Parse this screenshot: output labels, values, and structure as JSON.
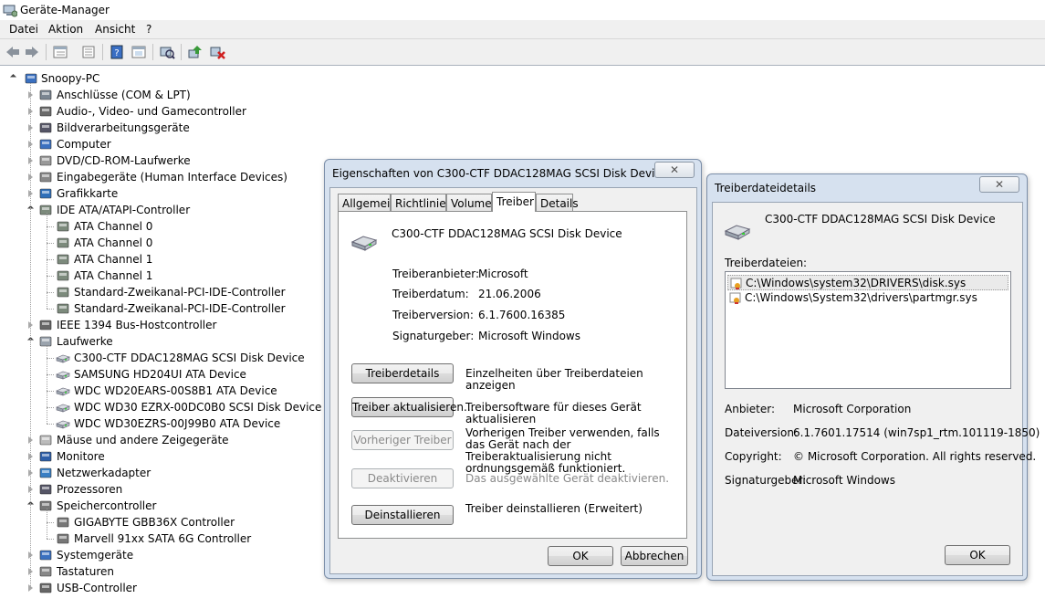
{
  "window": {
    "title": "Geräte-Manager"
  },
  "menu": [
    "Datei",
    "Aktion",
    "Ansicht",
    "?"
  ],
  "toolbar_icons": [
    "back-icon",
    "forward-icon",
    "properties-view-icon",
    "help-icon",
    "show-hidden-icon",
    "scan-hardware-icon",
    "update-driver-icon",
    "uninstall-icon"
  ],
  "tree": {
    "root": "Snoopy-PC",
    "items": [
      {
        "label": "Anschlüsse (COM & LPT)",
        "icon": "port-icon",
        "state": "closed"
      },
      {
        "label": "Audio-, Video- und Gamecontroller",
        "icon": "speaker-icon",
        "state": "closed"
      },
      {
        "label": "Bildverarbeitungsgeräte",
        "icon": "camera-icon",
        "state": "closed"
      },
      {
        "label": "Computer",
        "icon": "computer-icon",
        "state": "closed"
      },
      {
        "label": "DVD/CD-ROM-Laufwerke",
        "icon": "dvd-icon",
        "state": "closed"
      },
      {
        "label": "Eingabegeräte (Human Interface Devices)",
        "icon": "hid-icon",
        "state": "closed"
      },
      {
        "label": "Grafikkarte",
        "icon": "display-adapter-icon",
        "state": "closed"
      },
      {
        "label": "IDE ATA/ATAPI-Controller",
        "icon": "ide-icon",
        "state": "open",
        "children": [
          "ATA Channel 0",
          "ATA Channel 0",
          "ATA Channel 1",
          "ATA Channel 1",
          "Standard-Zweikanal-PCI-IDE-Controller",
          "Standard-Zweikanal-PCI-IDE-Controller"
        ]
      },
      {
        "label": "IEEE 1394 Bus-Hostcontroller",
        "icon": "firewire-icon",
        "state": "closed"
      },
      {
        "label": "Laufwerke",
        "icon": "disk-icon",
        "state": "open",
        "children": [
          "C300-CTF DDAC128MAG SCSI Disk Device",
          "SAMSUNG HD204UI ATA Device",
          "WDC WD20EARS-00S8B1 ATA Device",
          "WDC WD30 EZRX-00DC0B0 SCSI Disk Device",
          "WDC WD30EZRS-00J99B0 ATA Device"
        ]
      },
      {
        "label": "Mäuse und andere Zeigegeräte",
        "icon": "mouse-icon",
        "state": "closed"
      },
      {
        "label": "Monitore",
        "icon": "monitor-icon",
        "state": "closed"
      },
      {
        "label": "Netzwerkadapter",
        "icon": "network-icon",
        "state": "closed"
      },
      {
        "label": "Prozessoren",
        "icon": "cpu-icon",
        "state": "closed"
      },
      {
        "label": "Speichercontroller",
        "icon": "storage-controller-icon",
        "state": "open",
        "children": [
          "GIGABYTE GBB36X Controller",
          "Marvell 91xx SATA 6G Controller"
        ]
      },
      {
        "label": "Systemgeräte",
        "icon": "system-icon",
        "state": "closed"
      },
      {
        "label": "Tastaturen",
        "icon": "keyboard-icon",
        "state": "closed"
      },
      {
        "label": "USB-Controller",
        "icon": "usb-icon",
        "state": "closed"
      }
    ]
  },
  "props": {
    "title": "Eigenschaften von C300-CTF DDAC128MAG SCSI Disk Device",
    "close": "✕",
    "tabs": [
      "Allgemein",
      "Richtlinien",
      "Volumes",
      "Treiber",
      "Details"
    ],
    "active_tab": "Treiber",
    "device": "C300-CTF DDAC128MAG SCSI Disk Device",
    "fields": [
      {
        "label": "Treiberanbieter:",
        "value": "Microsoft"
      },
      {
        "label": "Treiberdatum:",
        "value": "21.06.2006"
      },
      {
        "label": "Treiberversion:",
        "value": "6.1.7600.16385"
      },
      {
        "label": "Signaturgeber:",
        "value": "Microsoft Windows"
      }
    ],
    "actions": [
      {
        "button": "Treiberdetails",
        "desc": "Einzelheiten über Treiberdateien anzeigen",
        "enabled": true
      },
      {
        "button": "Treiber aktualisieren...",
        "desc": "Treibersoftware für dieses Gerät aktualisieren",
        "enabled": true
      },
      {
        "button": "Vorheriger Treiber",
        "desc": "Vorherigen Treiber verwenden, falls das Gerät nach der Treiberaktualisierung nicht ordnungsgemäß funktioniert.",
        "enabled": false
      },
      {
        "button": "Deaktivieren",
        "desc": "Das ausgewählte Gerät deaktivieren.",
        "enabled": false
      },
      {
        "button": "Deinstallieren",
        "desc": "Treiber deinstallieren (Erweitert)",
        "enabled": true
      }
    ],
    "ok": "OK",
    "cancel": "Abbrechen"
  },
  "details": {
    "title": "Treiberdateidetails",
    "close": "✕",
    "device": "C300-CTF DDAC128MAG SCSI Disk Device",
    "files_label": "Treiberdateien:",
    "files": [
      "C:\\Windows\\system32\\DRIVERS\\disk.sys",
      "C:\\Windows\\System32\\drivers\\partmgr.sys"
    ],
    "fields": [
      {
        "label": "Anbieter:",
        "value": "Microsoft Corporation"
      },
      {
        "label": "Dateiversion:",
        "value": "6.1.7601.17514 (win7sp1_rtm.101119-1850)"
      },
      {
        "label": "Copyright:",
        "value": "© Microsoft Corporation. All rights reserved."
      },
      {
        "label": "Signaturgeber:",
        "value": "Microsoft Windows"
      }
    ],
    "ok": "OK"
  }
}
